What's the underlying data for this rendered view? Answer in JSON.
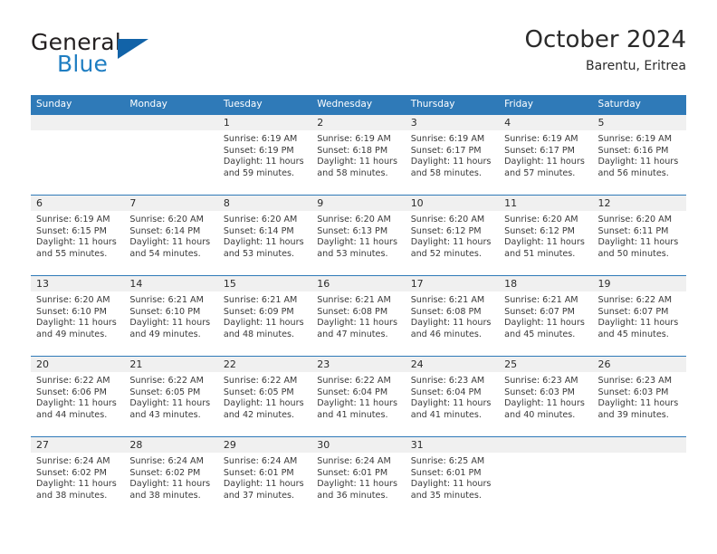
{
  "brand": {
    "name_part1": "General",
    "name_part2": "Blue",
    "logo_icon": "triangle-logo-icon",
    "accent_color": "#1263a8",
    "text_color": "#231f20"
  },
  "header": {
    "title": "October 2024",
    "subtitle": "Barentu, Eritrea"
  },
  "calendar": {
    "header_color": "#2f7ab8",
    "day_number_background": "#f0f0f0",
    "weekdays": [
      "Sunday",
      "Monday",
      "Tuesday",
      "Wednesday",
      "Thursday",
      "Friday",
      "Saturday"
    ],
    "weeks": [
      [
        {
          "day": "",
          "sunrise": "",
          "sunset": "",
          "daylight_line1": "",
          "daylight_line2": ""
        },
        {
          "day": "",
          "sunrise": "",
          "sunset": "",
          "daylight_line1": "",
          "daylight_line2": ""
        },
        {
          "day": "1",
          "sunrise": "Sunrise: 6:19 AM",
          "sunset": "Sunset: 6:19 PM",
          "daylight_line1": "Daylight: 11 hours",
          "daylight_line2": "and 59 minutes."
        },
        {
          "day": "2",
          "sunrise": "Sunrise: 6:19 AM",
          "sunset": "Sunset: 6:18 PM",
          "daylight_line1": "Daylight: 11 hours",
          "daylight_line2": "and 58 minutes."
        },
        {
          "day": "3",
          "sunrise": "Sunrise: 6:19 AM",
          "sunset": "Sunset: 6:17 PM",
          "daylight_line1": "Daylight: 11 hours",
          "daylight_line2": "and 58 minutes."
        },
        {
          "day": "4",
          "sunrise": "Sunrise: 6:19 AM",
          "sunset": "Sunset: 6:17 PM",
          "daylight_line1": "Daylight: 11 hours",
          "daylight_line2": "and 57 minutes."
        },
        {
          "day": "5",
          "sunrise": "Sunrise: 6:19 AM",
          "sunset": "Sunset: 6:16 PM",
          "daylight_line1": "Daylight: 11 hours",
          "daylight_line2": "and 56 minutes."
        }
      ],
      [
        {
          "day": "6",
          "sunrise": "Sunrise: 6:19 AM",
          "sunset": "Sunset: 6:15 PM",
          "daylight_line1": "Daylight: 11 hours",
          "daylight_line2": "and 55 minutes."
        },
        {
          "day": "7",
          "sunrise": "Sunrise: 6:20 AM",
          "sunset": "Sunset: 6:14 PM",
          "daylight_line1": "Daylight: 11 hours",
          "daylight_line2": "and 54 minutes."
        },
        {
          "day": "8",
          "sunrise": "Sunrise: 6:20 AM",
          "sunset": "Sunset: 6:14 PM",
          "daylight_line1": "Daylight: 11 hours",
          "daylight_line2": "and 53 minutes."
        },
        {
          "day": "9",
          "sunrise": "Sunrise: 6:20 AM",
          "sunset": "Sunset: 6:13 PM",
          "daylight_line1": "Daylight: 11 hours",
          "daylight_line2": "and 53 minutes."
        },
        {
          "day": "10",
          "sunrise": "Sunrise: 6:20 AM",
          "sunset": "Sunset: 6:12 PM",
          "daylight_line1": "Daylight: 11 hours",
          "daylight_line2": "and 52 minutes."
        },
        {
          "day": "11",
          "sunrise": "Sunrise: 6:20 AM",
          "sunset": "Sunset: 6:12 PM",
          "daylight_line1": "Daylight: 11 hours",
          "daylight_line2": "and 51 minutes."
        },
        {
          "day": "12",
          "sunrise": "Sunrise: 6:20 AM",
          "sunset": "Sunset: 6:11 PM",
          "daylight_line1": "Daylight: 11 hours",
          "daylight_line2": "and 50 minutes."
        }
      ],
      [
        {
          "day": "13",
          "sunrise": "Sunrise: 6:20 AM",
          "sunset": "Sunset: 6:10 PM",
          "daylight_line1": "Daylight: 11 hours",
          "daylight_line2": "and 49 minutes."
        },
        {
          "day": "14",
          "sunrise": "Sunrise: 6:21 AM",
          "sunset": "Sunset: 6:10 PM",
          "daylight_line1": "Daylight: 11 hours",
          "daylight_line2": "and 49 minutes."
        },
        {
          "day": "15",
          "sunrise": "Sunrise: 6:21 AM",
          "sunset": "Sunset: 6:09 PM",
          "daylight_line1": "Daylight: 11 hours",
          "daylight_line2": "and 48 minutes."
        },
        {
          "day": "16",
          "sunrise": "Sunrise: 6:21 AM",
          "sunset": "Sunset: 6:08 PM",
          "daylight_line1": "Daylight: 11 hours",
          "daylight_line2": "and 47 minutes."
        },
        {
          "day": "17",
          "sunrise": "Sunrise: 6:21 AM",
          "sunset": "Sunset: 6:08 PM",
          "daylight_line1": "Daylight: 11 hours",
          "daylight_line2": "and 46 minutes."
        },
        {
          "day": "18",
          "sunrise": "Sunrise: 6:21 AM",
          "sunset": "Sunset: 6:07 PM",
          "daylight_line1": "Daylight: 11 hours",
          "daylight_line2": "and 45 minutes."
        },
        {
          "day": "19",
          "sunrise": "Sunrise: 6:22 AM",
          "sunset": "Sunset: 6:07 PM",
          "daylight_line1": "Daylight: 11 hours",
          "daylight_line2": "and 45 minutes."
        }
      ],
      [
        {
          "day": "20",
          "sunrise": "Sunrise: 6:22 AM",
          "sunset": "Sunset: 6:06 PM",
          "daylight_line1": "Daylight: 11 hours",
          "daylight_line2": "and 44 minutes."
        },
        {
          "day": "21",
          "sunrise": "Sunrise: 6:22 AM",
          "sunset": "Sunset: 6:05 PM",
          "daylight_line1": "Daylight: 11 hours",
          "daylight_line2": "and 43 minutes."
        },
        {
          "day": "22",
          "sunrise": "Sunrise: 6:22 AM",
          "sunset": "Sunset: 6:05 PM",
          "daylight_line1": "Daylight: 11 hours",
          "daylight_line2": "and 42 minutes."
        },
        {
          "day": "23",
          "sunrise": "Sunrise: 6:22 AM",
          "sunset": "Sunset: 6:04 PM",
          "daylight_line1": "Daylight: 11 hours",
          "daylight_line2": "and 41 minutes."
        },
        {
          "day": "24",
          "sunrise": "Sunrise: 6:23 AM",
          "sunset": "Sunset: 6:04 PM",
          "daylight_line1": "Daylight: 11 hours",
          "daylight_line2": "and 41 minutes."
        },
        {
          "day": "25",
          "sunrise": "Sunrise: 6:23 AM",
          "sunset": "Sunset: 6:03 PM",
          "daylight_line1": "Daylight: 11 hours",
          "daylight_line2": "and 40 minutes."
        },
        {
          "day": "26",
          "sunrise": "Sunrise: 6:23 AM",
          "sunset": "Sunset: 6:03 PM",
          "daylight_line1": "Daylight: 11 hours",
          "daylight_line2": "and 39 minutes."
        }
      ],
      [
        {
          "day": "27",
          "sunrise": "Sunrise: 6:24 AM",
          "sunset": "Sunset: 6:02 PM",
          "daylight_line1": "Daylight: 11 hours",
          "daylight_line2": "and 38 minutes."
        },
        {
          "day": "28",
          "sunrise": "Sunrise: 6:24 AM",
          "sunset": "Sunset: 6:02 PM",
          "daylight_line1": "Daylight: 11 hours",
          "daylight_line2": "and 38 minutes."
        },
        {
          "day": "29",
          "sunrise": "Sunrise: 6:24 AM",
          "sunset": "Sunset: 6:01 PM",
          "daylight_line1": "Daylight: 11 hours",
          "daylight_line2": "and 37 minutes."
        },
        {
          "day": "30",
          "sunrise": "Sunrise: 6:24 AM",
          "sunset": "Sunset: 6:01 PM",
          "daylight_line1": "Daylight: 11 hours",
          "daylight_line2": "and 36 minutes."
        },
        {
          "day": "31",
          "sunrise": "Sunrise: 6:25 AM",
          "sunset": "Sunset: 6:01 PM",
          "daylight_line1": "Daylight: 11 hours",
          "daylight_line2": "and 35 minutes."
        },
        {
          "day": "",
          "sunrise": "",
          "sunset": "",
          "daylight_line1": "",
          "daylight_line2": ""
        },
        {
          "day": "",
          "sunrise": "",
          "sunset": "",
          "daylight_line1": "",
          "daylight_line2": ""
        }
      ]
    ]
  }
}
